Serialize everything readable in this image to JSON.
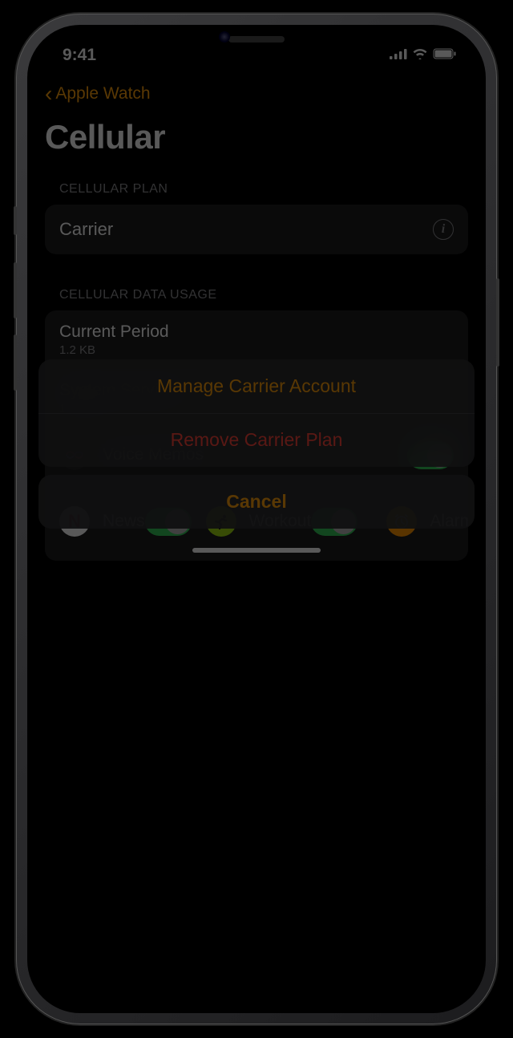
{
  "status": {
    "time": "9:41"
  },
  "nav": {
    "back_label": "Apple Watch"
  },
  "page": {
    "title": "Cellular"
  },
  "plan_section": {
    "header": "CELLULAR PLAN",
    "carrier_label": "Carrier"
  },
  "usage_section": {
    "header": "CELLULAR DATA USAGE",
    "current_period": {
      "label": "Current Period",
      "value": "1.2 KB"
    },
    "system_services": {
      "label": "System Services",
      "value": "1.2 KB"
    },
    "apps": [
      {
        "name": "Voice Memos",
        "enabled": true,
        "icon": "voice-memos"
      },
      {
        "name": "News",
        "enabled": true,
        "icon": "news"
      },
      {
        "name": "Workout",
        "enabled": true,
        "icon": "workout"
      },
      {
        "name": "Alarms",
        "enabled": true,
        "icon": "alarms"
      }
    ]
  },
  "action_sheet": {
    "manage": "Manage Carrier Account",
    "remove": "Remove Carrier Plan",
    "cancel": "Cancel"
  }
}
